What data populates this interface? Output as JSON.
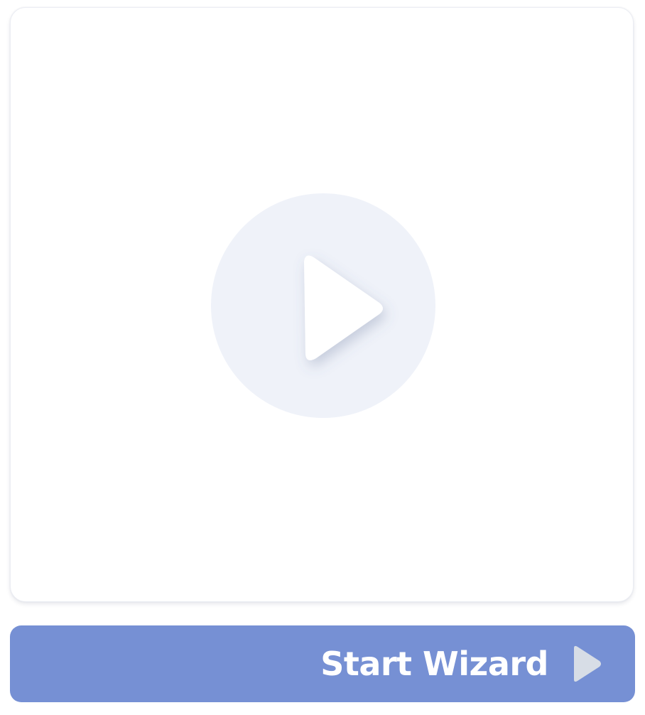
{
  "video_card": {
    "play_icon": "play-icon",
    "colors": {
      "circle": "#eff2f9",
      "triangle": "#ffffff"
    }
  },
  "start_wizard": {
    "label": "Start Wizard",
    "icon": "play-arrow-icon",
    "colors": {
      "background": "#7690d4",
      "text": "#ffffff",
      "icon": "#d7dde6"
    }
  }
}
